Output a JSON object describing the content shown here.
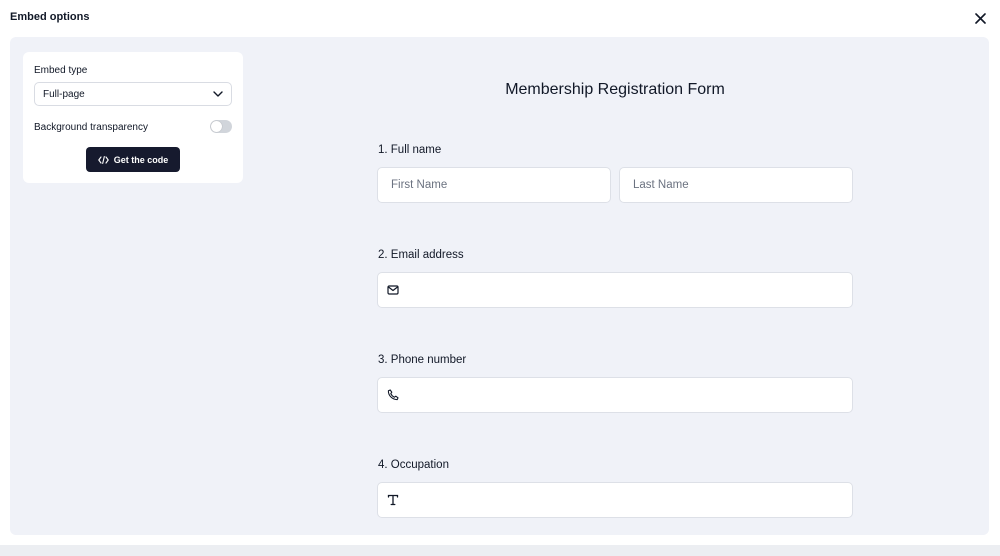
{
  "header": {
    "title": "Embed options"
  },
  "panel": {
    "embed_type_label": "Embed type",
    "embed_type_value": "Full-page",
    "transparency_label": "Background transparency",
    "transparency_enabled": false,
    "get_code_label": "Get the code"
  },
  "form": {
    "title": "Membership Registration Form",
    "questions": [
      {
        "label": "1.  Full name",
        "first_placeholder": "First Name",
        "last_placeholder": "Last Name"
      },
      {
        "label": "2. Email address",
        "icon": "mail-icon"
      },
      {
        "label": "3. Phone number",
        "icon": "phone-icon"
      },
      {
        "label": "4. Occupation",
        "icon": "text-icon"
      }
    ]
  },
  "colors": {
    "preview_bg": "#f0f2f8",
    "button_bg": "#161a2e",
    "toggle_off": "#d1d5db"
  }
}
